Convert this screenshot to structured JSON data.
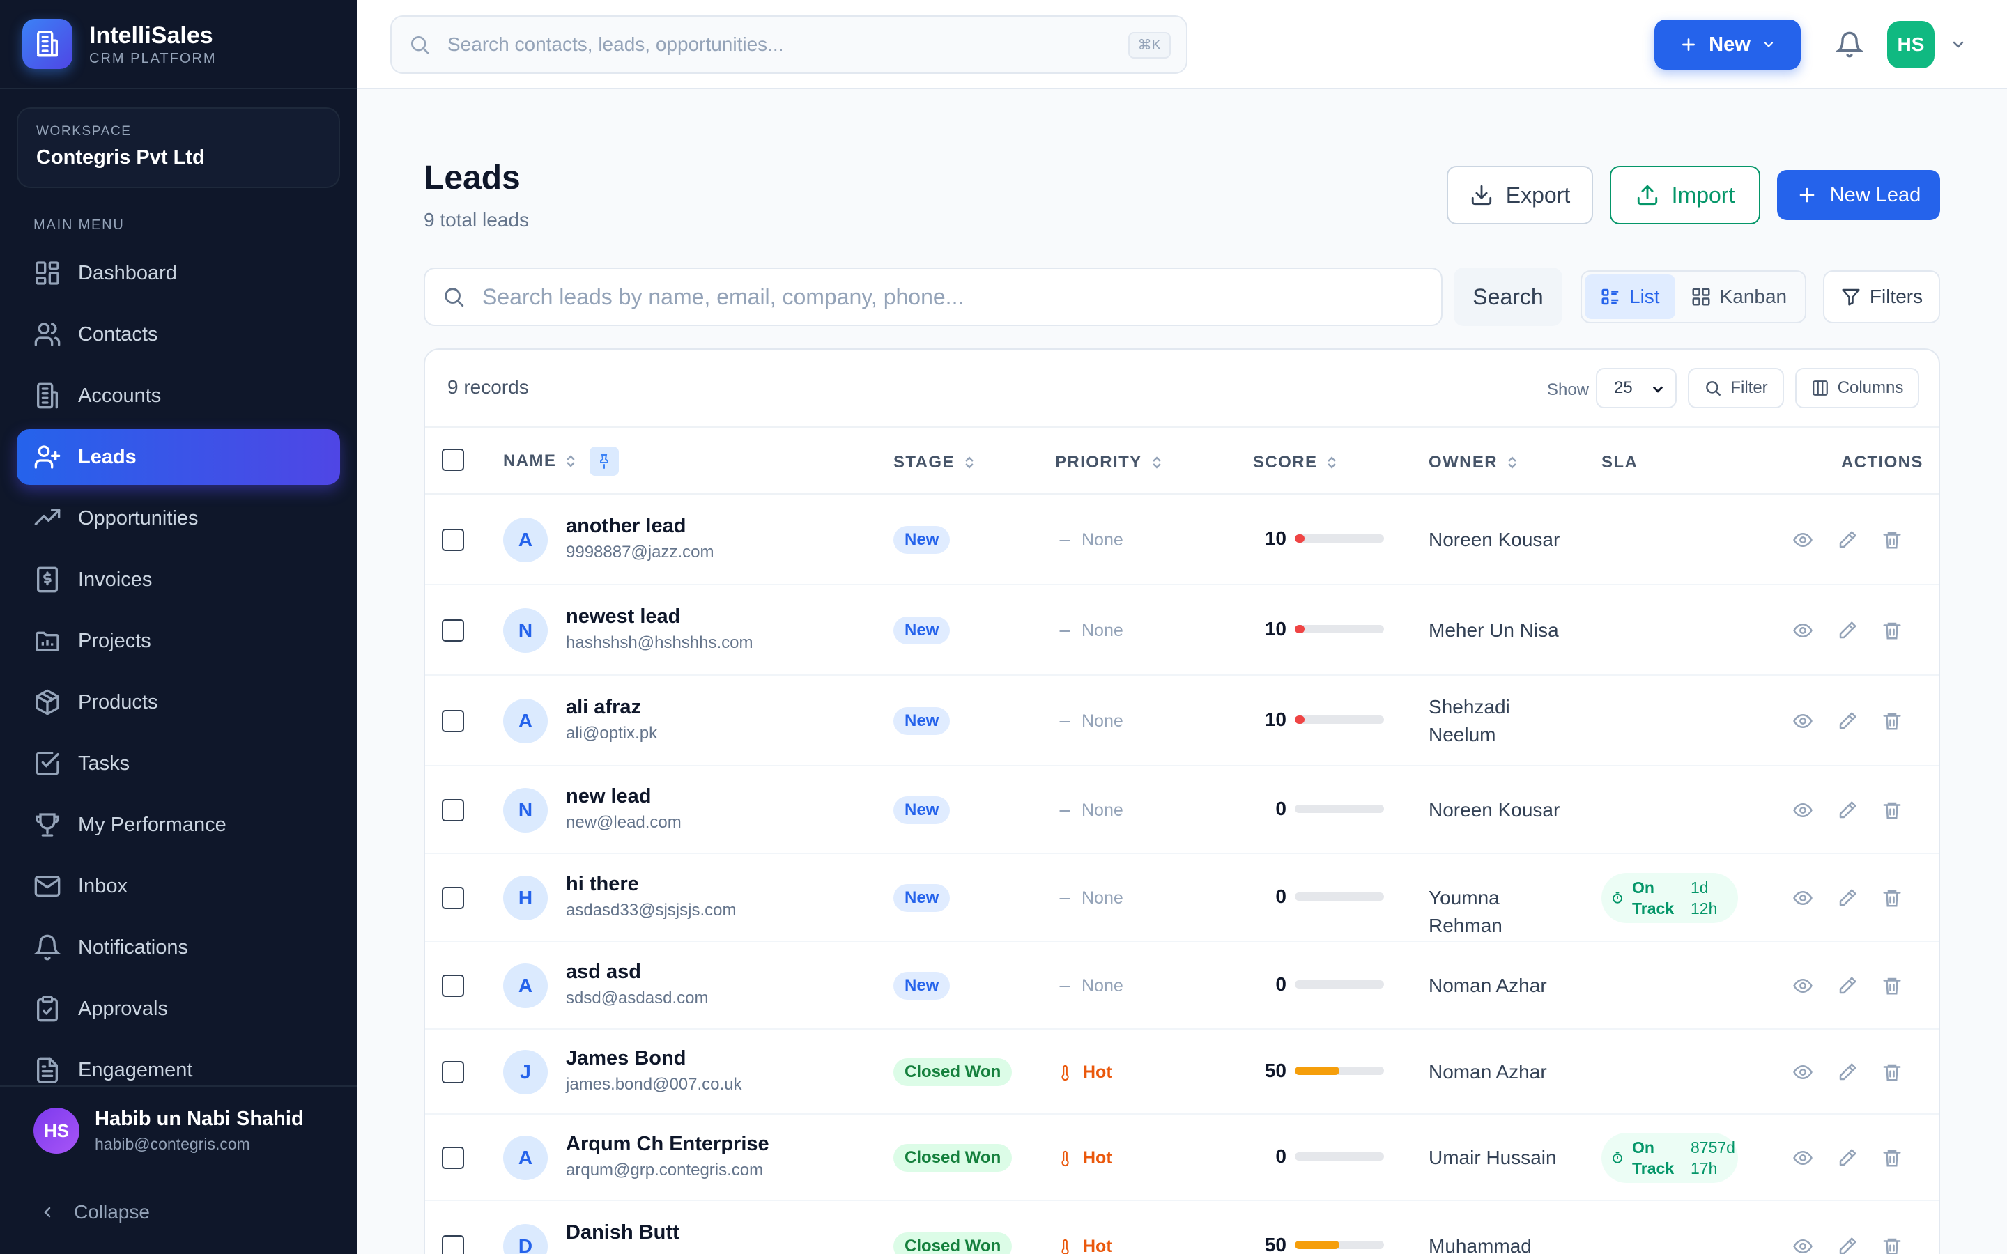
{
  "brand": {
    "name": "IntelliSales",
    "subtitle": "CRM PLATFORM"
  },
  "workspace": {
    "label": "WORKSPACE",
    "name": "Contegris Pvt Ltd"
  },
  "sidebar": {
    "menu_label": "MAIN MENU",
    "items": [
      {
        "label": "Dashboard",
        "icon": "dashboard-icon"
      },
      {
        "label": "Contacts",
        "icon": "users-icon"
      },
      {
        "label": "Accounts",
        "icon": "building-icon"
      },
      {
        "label": "Leads",
        "icon": "user-plus-icon",
        "active": true
      },
      {
        "label": "Opportunities",
        "icon": "trending-up-icon"
      },
      {
        "label": "Invoices",
        "icon": "receipt-icon"
      },
      {
        "label": "Projects",
        "icon": "folder-icon"
      },
      {
        "label": "Products",
        "icon": "package-icon"
      },
      {
        "label": "Tasks",
        "icon": "check-square-icon"
      },
      {
        "label": "My Performance",
        "icon": "trophy-icon"
      },
      {
        "label": "Inbox",
        "icon": "mail-icon"
      },
      {
        "label": "Notifications",
        "icon": "bell-icon"
      },
      {
        "label": "Approvals",
        "icon": "clipboard-check-icon"
      },
      {
        "label": "Engagement",
        "icon": "file-text-icon"
      }
    ],
    "user": {
      "initials": "HS",
      "name": "Habib un Nabi Shahid",
      "email": "habib@contegris.com"
    },
    "collapse_label": "Collapse"
  },
  "topbar": {
    "search_placeholder": "Search contacts, leads, opportunities...",
    "shortcut": "⌘K",
    "new_label": "New",
    "avatar_initials": "HS"
  },
  "page": {
    "title": "Leads",
    "subtitle": "9 total leads",
    "export_label": "Export",
    "import_label": "Import",
    "new_lead_label": "New Lead",
    "search_placeholder": "Search leads by name, email, company, phone...",
    "search_button": "Search",
    "view_list": "List",
    "view_kanban": "Kanban",
    "filters_label": "Filters"
  },
  "table": {
    "records_label": "9 records",
    "show_label": "Show",
    "page_size": "25",
    "filter_label": "Filter",
    "columns_label": "Columns",
    "headers": {
      "name": "NAME",
      "stage": "STAGE",
      "priority": "PRIORITY",
      "score": "SCORE",
      "owner": "OWNER",
      "sla": "SLA",
      "actions": "ACTIONS"
    },
    "rows": [
      {
        "initial": "A",
        "name": "another lead",
        "email": "9998887@jazz.com",
        "stage": "New",
        "stage_kind": "new",
        "priority": "None",
        "score": "10",
        "owner": "Noreen Kousar",
        "sla_status": "",
        "sla_time": ""
      },
      {
        "initial": "N",
        "name": "newest lead",
        "email": "hashshsh@hshshhs.com",
        "stage": "New",
        "stage_kind": "new",
        "priority": "None",
        "score": "10",
        "owner": "Meher Un Nisa",
        "sla_status": "",
        "sla_time": ""
      },
      {
        "initial": "A",
        "name": "ali afraz",
        "email": "ali@optix.pk",
        "stage": "New",
        "stage_kind": "new",
        "priority": "None",
        "score": "10",
        "owner": "Shehzadi Neelum",
        "sla_status": "",
        "sla_time": ""
      },
      {
        "initial": "N",
        "name": "new lead",
        "email": "new@lead.com",
        "stage": "New",
        "stage_kind": "new",
        "priority": "None",
        "score": "0",
        "owner": "Noreen Kousar",
        "sla_status": "",
        "sla_time": ""
      },
      {
        "initial": "H",
        "name": "hi there",
        "email": "asdasd33@sjsjsjs.com",
        "stage": "New",
        "stage_kind": "new",
        "priority": "None",
        "score": "0",
        "owner": "Youmna Rehman",
        "sla_status": "On Track",
        "sla_time": "1d 12h"
      },
      {
        "initial": "A",
        "name": "asd asd",
        "email": "sdsd@asdasd.com",
        "stage": "New",
        "stage_kind": "new",
        "priority": "None",
        "score": "0",
        "owner": "Noman Azhar",
        "sla_status": "",
        "sla_time": ""
      },
      {
        "initial": "J",
        "name": "James Bond",
        "email": "james.bond@007.co.uk",
        "stage": "Closed Won",
        "stage_kind": "won",
        "priority": "Hot",
        "score": "50",
        "owner": "Noman Azhar",
        "sla_status": "",
        "sla_time": ""
      },
      {
        "initial": "A",
        "name": "Arqum Ch Enterprise",
        "email": "arqum@grp.contegris.com",
        "stage": "Closed Won",
        "stage_kind": "won",
        "priority": "Hot",
        "score": "0",
        "owner": "Umair Hussain",
        "sla_status": "On Track",
        "sla_time": "8757d 17h"
      },
      {
        "initial": "D",
        "name": "Danish Butt",
        "email": "",
        "stage": "Closed Won",
        "stage_kind": "won",
        "priority": "Hot",
        "score": "50",
        "owner": "Muhammad Talha",
        "sla_status": "",
        "sla_time": ""
      }
    ]
  },
  "colors": {
    "primary": "#2563eb",
    "sidebar_bg": "#0f172a",
    "success": "#059669",
    "hot": "#ea580c",
    "score_low": "#ef4444",
    "score_mid": "#f59e0b"
  }
}
